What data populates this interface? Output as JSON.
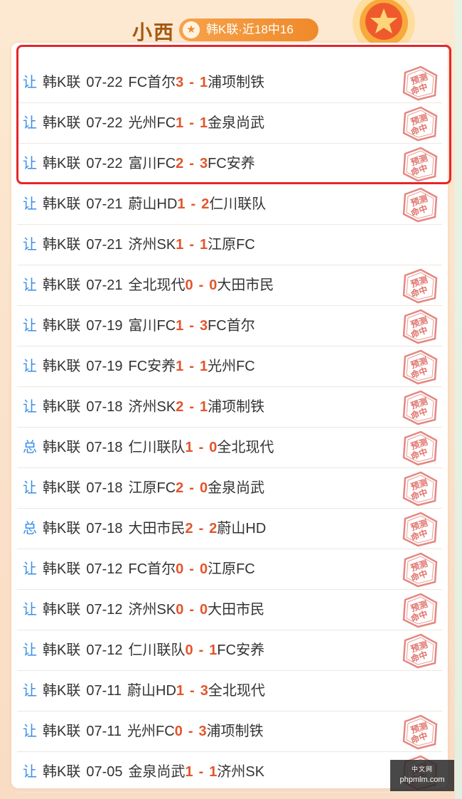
{
  "header": {
    "title": "小西",
    "badge_text": "韩K联·近18中16",
    "badge_icon": "star-icon",
    "medal_icon": "star-medal-icon"
  },
  "colors": {
    "score": "#e3552b",
    "bet_type": "#3a8ee6",
    "highlight": "#e5262a",
    "stamp": "#e0726a"
  },
  "stamp_text": [
    "预测",
    "命中"
  ],
  "matches": [
    {
      "type": "让",
      "league": "韩K联",
      "date": "07-22",
      "home": "FC首尔",
      "hs": "3",
      "as": "1",
      "away": "浦项制铁",
      "hit": true
    },
    {
      "type": "让",
      "league": "韩K联",
      "date": "07-22",
      "home": "光州FC",
      "hs": "1",
      "as": "1",
      "away": "金泉尚武",
      "hit": true
    },
    {
      "type": "让",
      "league": "韩K联",
      "date": "07-22",
      "home": "富川FC",
      "hs": "2",
      "as": "3",
      "away": "FC安养",
      "hit": true
    },
    {
      "type": "让",
      "league": "韩K联",
      "date": "07-21",
      "home": "蔚山HD",
      "hs": "1",
      "as": "2",
      "away": "仁川联队",
      "hit": true
    },
    {
      "type": "让",
      "league": "韩K联",
      "date": "07-21",
      "home": "济州SK",
      "hs": "1",
      "as": "1",
      "away": "江原FC",
      "hit": false
    },
    {
      "type": "让",
      "league": "韩K联",
      "date": "07-21",
      "home": "全北现代",
      "hs": "0",
      "as": "0",
      "away": "大田市民",
      "hit": true
    },
    {
      "type": "让",
      "league": "韩K联",
      "date": "07-19",
      "home": "富川FC",
      "hs": "1",
      "as": "3",
      "away": "FC首尔",
      "hit": true
    },
    {
      "type": "让",
      "league": "韩K联",
      "date": "07-19",
      "home": "FC安养",
      "hs": "1",
      "as": "1",
      "away": "光州FC",
      "hit": true
    },
    {
      "type": "让",
      "league": "韩K联",
      "date": "07-18",
      "home": "济州SK",
      "hs": "2",
      "as": "1",
      "away": "浦项制铁",
      "hit": true
    },
    {
      "type": "总",
      "league": "韩K联",
      "date": "07-18",
      "home": "仁川联队",
      "hs": "1",
      "as": "0",
      "away": "全北现代",
      "hit": true
    },
    {
      "type": "让",
      "league": "韩K联",
      "date": "07-18",
      "home": "江原FC",
      "hs": "2",
      "as": "0",
      "away": "金泉尚武",
      "hit": true
    },
    {
      "type": "总",
      "league": "韩K联",
      "date": "07-18",
      "home": "大田市民",
      "hs": "2",
      "as": "2",
      "away": "蔚山HD",
      "hit": true
    },
    {
      "type": "让",
      "league": "韩K联",
      "date": "07-12",
      "home": "FC首尔",
      "hs": "0",
      "as": "0",
      "away": "江原FC",
      "hit": true
    },
    {
      "type": "让",
      "league": "韩K联",
      "date": "07-12",
      "home": "济州SK",
      "hs": "0",
      "as": "0",
      "away": "大田市民",
      "hit": true
    },
    {
      "type": "让",
      "league": "韩K联",
      "date": "07-12",
      "home": "仁川联队",
      "hs": "0",
      "as": "1",
      "away": "FC安养",
      "hit": true
    },
    {
      "type": "让",
      "league": "韩K联",
      "date": "07-11",
      "home": "蔚山HD",
      "hs": "1",
      "as": "3",
      "away": "全北现代",
      "hit": false
    },
    {
      "type": "让",
      "league": "韩K联",
      "date": "07-11",
      "home": "光州FC",
      "hs": "0",
      "as": "3",
      "away": "浦项制铁",
      "hit": true
    },
    {
      "type": "让",
      "league": "韩K联",
      "date": "07-05",
      "home": "金泉尚武",
      "hs": "1",
      "as": "1",
      "away": "济州SK",
      "hit": true
    }
  ],
  "watermark": {
    "top": "中文网",
    "bottom": "phpmlm.com"
  }
}
